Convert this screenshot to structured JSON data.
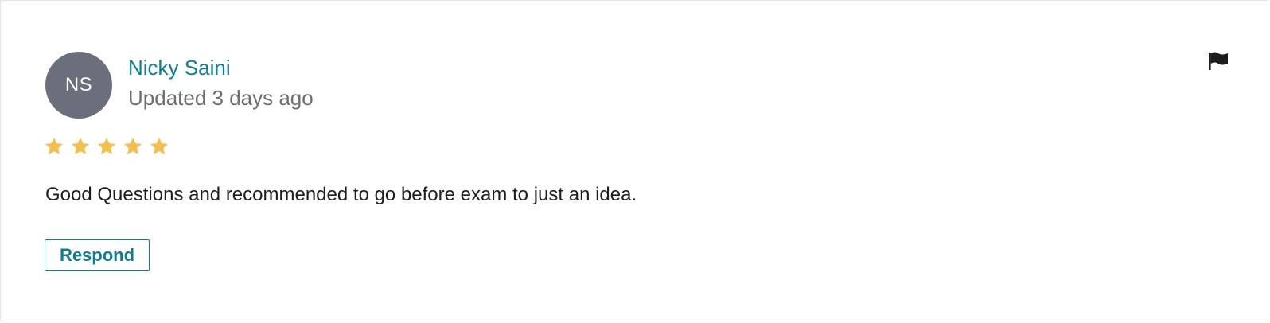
{
  "review": {
    "author_initials": "NS",
    "author_name": "Nicky Saini",
    "updated_text": "Updated 3 days ago",
    "rating": 5,
    "rating_max": 5,
    "text": "Good Questions and recommended to go before exam to just an idea.",
    "respond_label": "Respond",
    "flag_icon": "flag-icon"
  },
  "colors": {
    "accent": "#0f7c90",
    "star": "#f3c04f",
    "avatar_bg": "#6a6f7b"
  }
}
